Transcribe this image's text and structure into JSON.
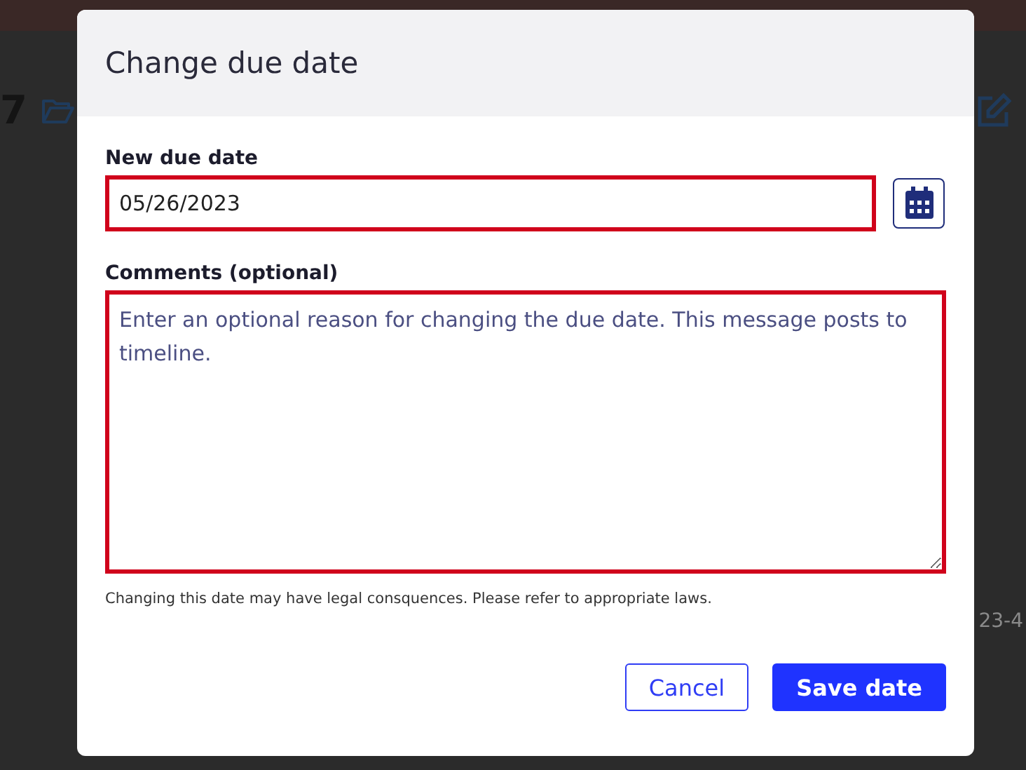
{
  "background": {
    "record_number": "7",
    "row_text": "23-4"
  },
  "dialog": {
    "title": "Change due date",
    "due_date": {
      "label": "New due date",
      "value": "05/26/2023",
      "invalid": true
    },
    "comments": {
      "label": "Comments (optional)",
      "placeholder": "Enter an optional reason for changing the due date. This message posts to timeline.",
      "invalid": true
    },
    "note": "Changing this date may have legal consquences. Please refer to appropriate laws.",
    "buttons": [
      {
        "label": "Cancel",
        "kind": "secondary"
      },
      {
        "label": "Save date",
        "kind": "primary"
      }
    ]
  }
}
